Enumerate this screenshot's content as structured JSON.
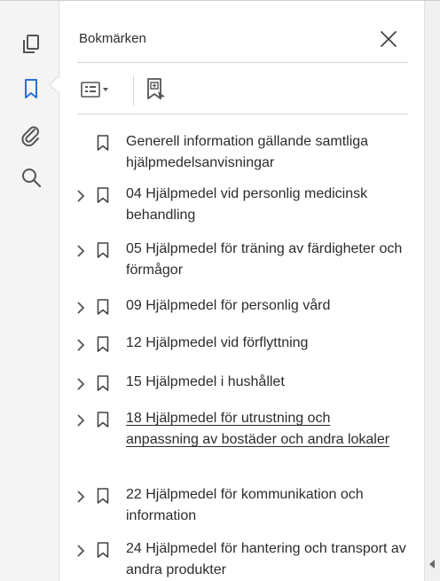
{
  "rail": {
    "icons": [
      "pages-icon",
      "bookmark-icon",
      "attachment-icon",
      "search-icon"
    ],
    "active": "bookmark-icon",
    "accent": "#2b6fd6"
  },
  "panel": {
    "title": "Bokmärken",
    "close_icon": "close-icon",
    "toolbar": {
      "options_icon": "bookmark-options-icon",
      "new_bookmark_icon": "new-bookmark-icon"
    }
  },
  "bookmarks": [
    {
      "label": "Generell information gällande samtliga hjälpmedelsanvisningar",
      "expandable": false
    },
    {
      "label": "04 Hjälpmedel vid personlig medicinsk behandling",
      "expandable": true
    },
    {
      "label": "05 Hjälpmedel för träning av färdigheter och förmågor",
      "expandable": true
    },
    {
      "label": "09 Hjälpmedel för personlig vård",
      "expandable": true
    },
    {
      "label": "12 Hjälpmedel vid förflyttning",
      "expandable": true
    },
    {
      "label": "15 Hjälpmedel i hushållet",
      "expandable": true
    },
    {
      "label": "18 Hjälpmedel för utrustning och anpassning av bostäder och andra lokaler",
      "expandable": true,
      "hovered": true
    },
    {
      "label": "22 Hjälpmedel för kommunikation och information",
      "expandable": true
    },
    {
      "label": "24 Hjälpmedel för hantering och transport av andra produkter",
      "expandable": true
    }
  ]
}
